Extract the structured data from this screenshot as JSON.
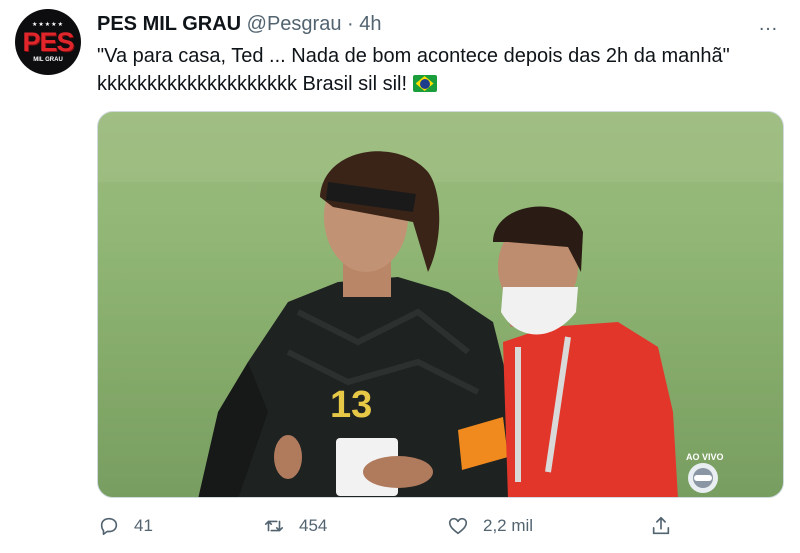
{
  "author": {
    "display_name": "PES MIL GRAU",
    "handle": "@Pesgrau",
    "separator": "·",
    "time": "4h",
    "avatar": {
      "stars": "★★★★★",
      "text": "PES",
      "sub": "MIL GRAU"
    }
  },
  "more_icon": "…",
  "tweet": {
    "line1": "\"Va para casa, Ted ... Nada de bom acontece depois das 2h da manhã\"",
    "line2": "kkkkkkkkkkkkkkkkkkkk Brasil sil sil!",
    "flag_icon": "brazil-flag-icon"
  },
  "media": {
    "jersey_number": "13",
    "broadcast_label": "AO VIVO"
  },
  "actions": {
    "reply_count": "41",
    "retweet_count": "454",
    "like_count": "2,2 mil"
  },
  "colors": {
    "text": "#0f1419",
    "secondary": "#536471",
    "pitch": "#8fb574",
    "jersey": "#1c1f1e",
    "staff_shirt": "#e2362a"
  }
}
